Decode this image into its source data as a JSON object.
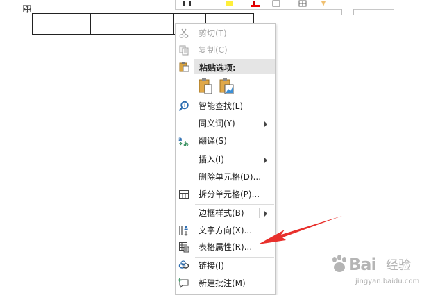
{
  "menu": {
    "cut": {
      "label": "剪切(T)",
      "icon": "scissors-icon",
      "disabled": true
    },
    "copy": {
      "label": "复制(C)",
      "icon": "copy-icon",
      "disabled": true
    },
    "paste_options": {
      "label": "粘贴选项:",
      "icon": "clipboard-icon",
      "options": [
        "paste-keep-text-icon",
        "paste-picture-icon"
      ]
    },
    "smart_lookup": {
      "label": "智能查找(L)",
      "icon": "search-icon"
    },
    "synonyms": {
      "label": "同义词(Y)",
      "has_submenu": true
    },
    "translate": {
      "label": "翻译(S)",
      "icon": "translate-icon"
    },
    "insert": {
      "label": "插入(I)",
      "has_submenu": true
    },
    "delete_cells": {
      "label": "删除单元格(D)..."
    },
    "split_cells": {
      "label": "拆分单元格(P)...",
      "icon": "split-cells-icon"
    },
    "border_styles": {
      "label": "边框样式(B)",
      "has_submenu": true
    },
    "text_direction": {
      "label": "文字方向(X)...",
      "icon": "text-direction-icon"
    },
    "table_properties": {
      "label": "表格属性(R)...",
      "icon": "table-properties-icon"
    },
    "link": {
      "label": "链接(I)",
      "icon": "link-icon"
    },
    "new_comment": {
      "label": "新建批注(M)",
      "icon": "comment-icon"
    }
  },
  "watermark": {
    "brand": "Bai",
    "cn": "经验",
    "url": "jingyan.baidu.com"
  },
  "colors": {
    "annotation_arrow": "#e8302c",
    "menu_highlight": "#e5e5e5",
    "icon_blue": "#2b6cb0",
    "icon_green": "#2e8b57",
    "disabled_text": "#a6a6a6"
  }
}
